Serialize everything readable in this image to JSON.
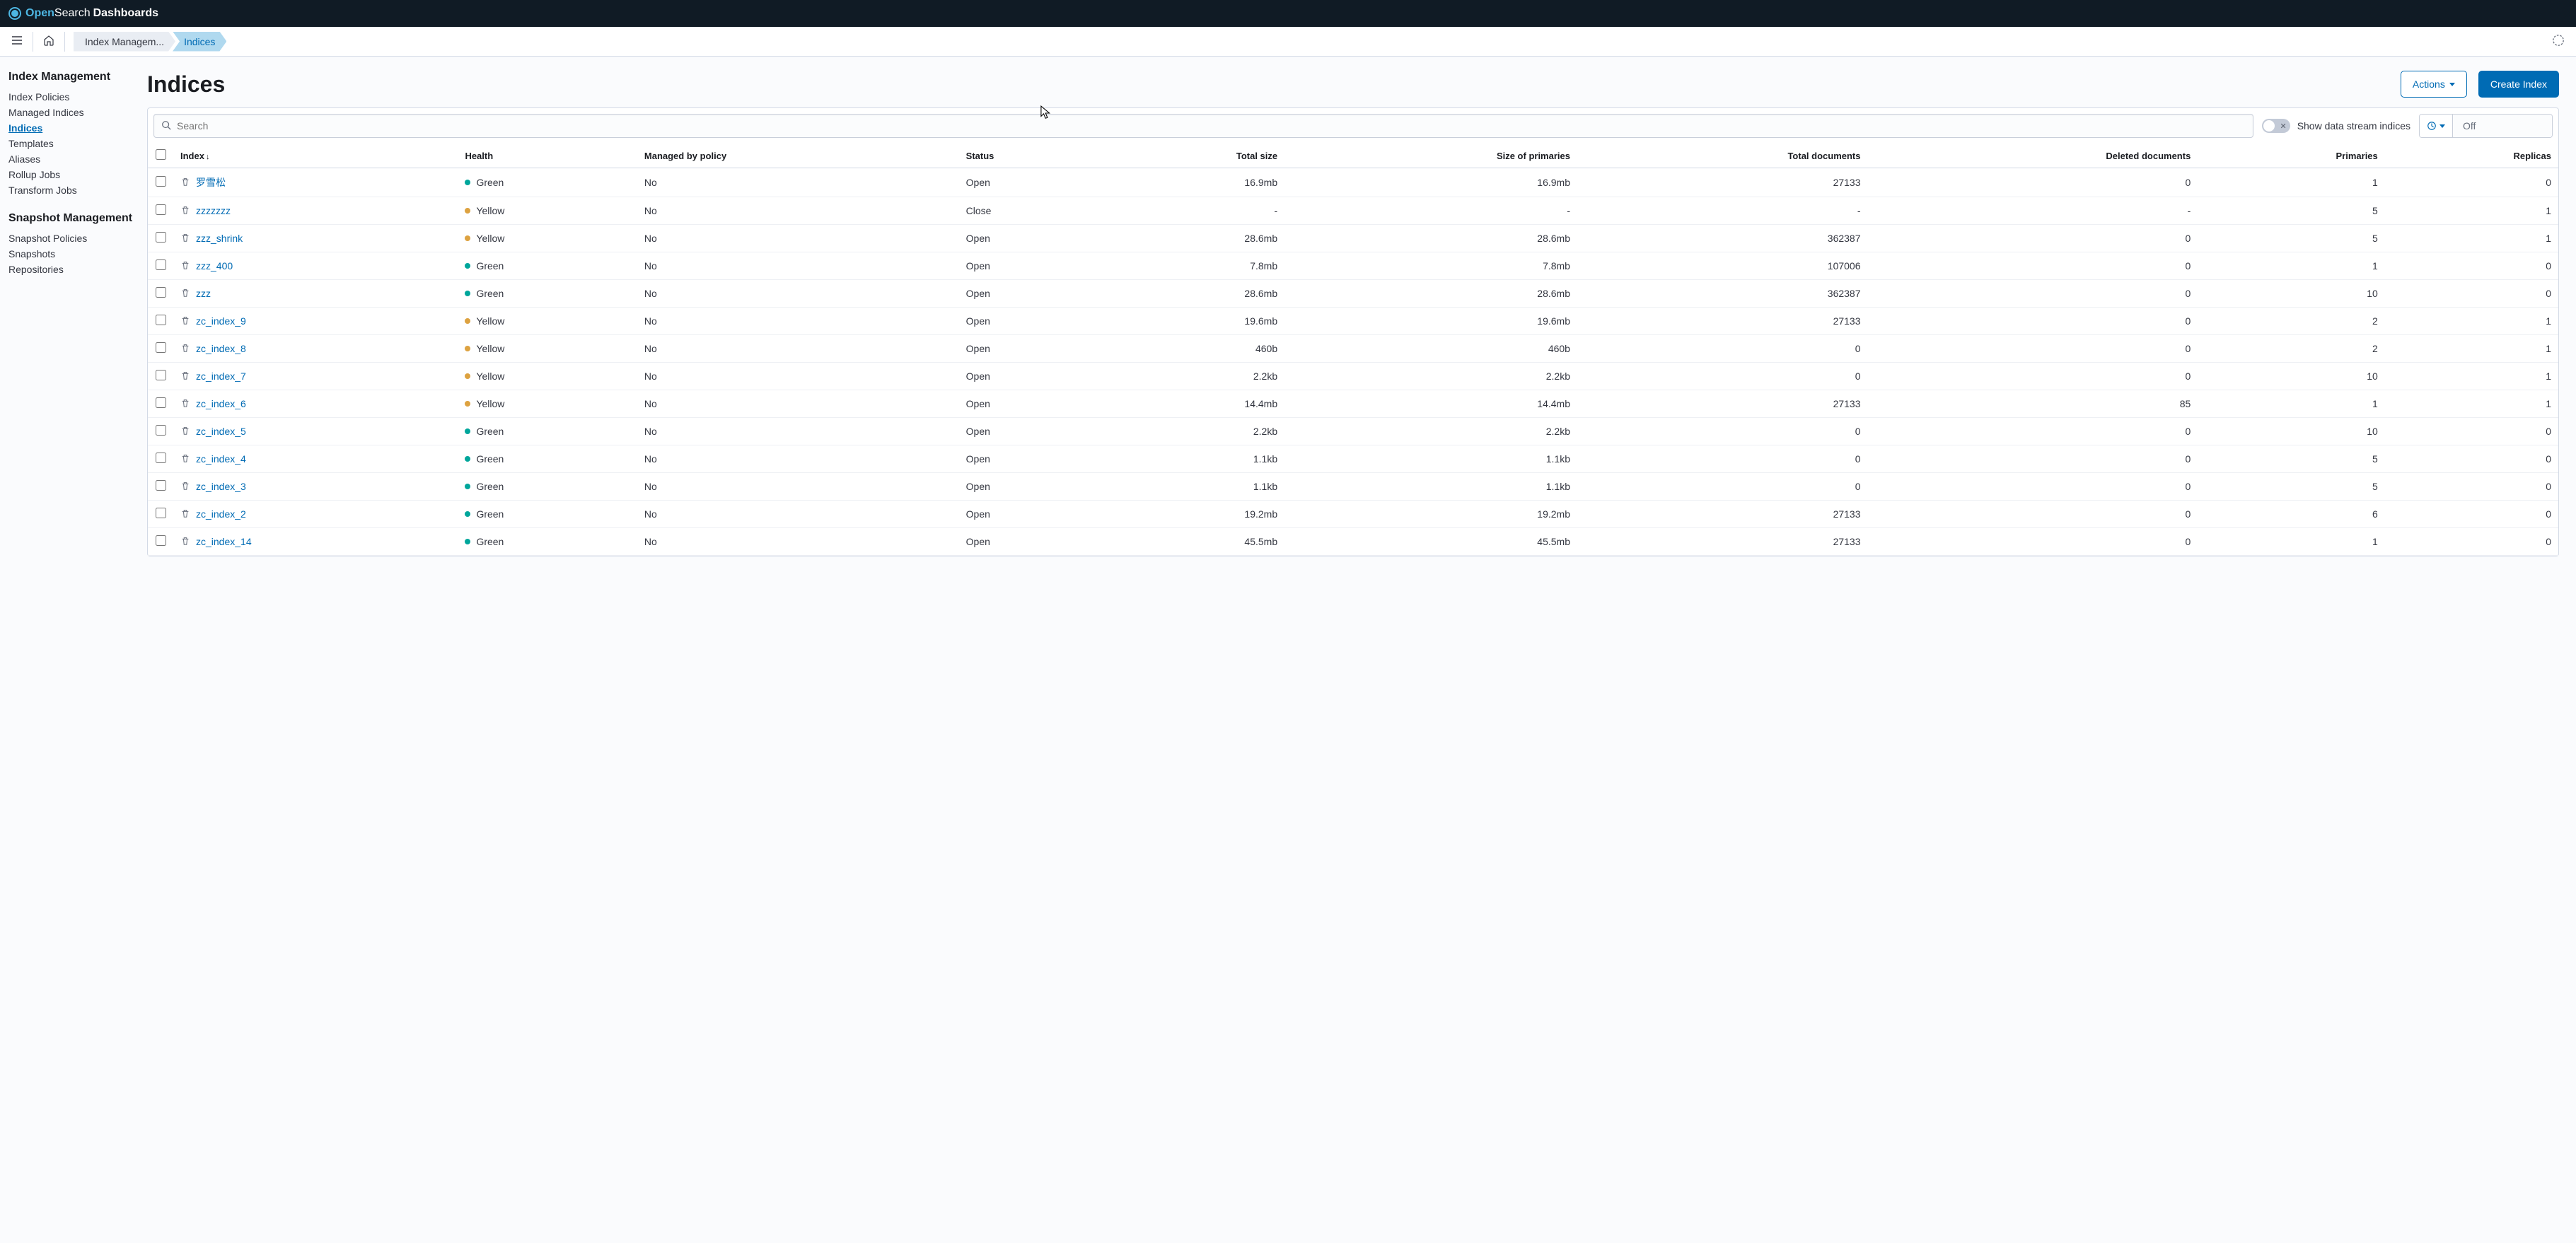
{
  "brand": {
    "open": "Open",
    "search": "Search",
    "dashboards": "Dashboards"
  },
  "breadcrumbs": [
    {
      "label": "Index Managem..."
    },
    {
      "label": "Indices"
    }
  ],
  "sidebar": {
    "group1": {
      "title": "Index Management",
      "items": [
        "Index Policies",
        "Managed Indices",
        "Indices",
        "Templates",
        "Aliases",
        "Rollup Jobs",
        "Transform Jobs"
      ]
    },
    "group2": {
      "title": "Snapshot Management",
      "items": [
        "Snapshot Policies",
        "Snapshots",
        "Repositories"
      ]
    }
  },
  "page": {
    "title": "Indices",
    "actions_label": "Actions",
    "create_label": "Create Index"
  },
  "toolbar": {
    "search_placeholder": "Search",
    "switch_label": "Show data stream indices",
    "refresh_state": "Off"
  },
  "columns": {
    "index": "Index",
    "health": "Health",
    "managed": "Managed by policy",
    "status": "Status",
    "total_size": "Total size",
    "size_primaries": "Size of primaries",
    "total_docs": "Total documents",
    "deleted_docs": "Deleted documents",
    "primaries": "Primaries",
    "replicas": "Replicas"
  },
  "rows": [
    {
      "index": "罗雪松",
      "health": "Green",
      "managed": "No",
      "status": "Open",
      "total_size": "16.9mb",
      "size_primaries": "16.9mb",
      "total_docs": "27133",
      "deleted_docs": "0",
      "primaries": "1",
      "replicas": "0"
    },
    {
      "index": "zzzzzzz",
      "health": "Yellow",
      "managed": "No",
      "status": "Close",
      "total_size": "-",
      "size_primaries": "-",
      "total_docs": "-",
      "deleted_docs": "-",
      "primaries": "5",
      "replicas": "1"
    },
    {
      "index": "zzz_shrink",
      "health": "Yellow",
      "managed": "No",
      "status": "Open",
      "total_size": "28.6mb",
      "size_primaries": "28.6mb",
      "total_docs": "362387",
      "deleted_docs": "0",
      "primaries": "5",
      "replicas": "1"
    },
    {
      "index": "zzz_400",
      "health": "Green",
      "managed": "No",
      "status": "Open",
      "total_size": "7.8mb",
      "size_primaries": "7.8mb",
      "total_docs": "107006",
      "deleted_docs": "0",
      "primaries": "1",
      "replicas": "0"
    },
    {
      "index": "zzz",
      "health": "Green",
      "managed": "No",
      "status": "Open",
      "total_size": "28.6mb",
      "size_primaries": "28.6mb",
      "total_docs": "362387",
      "deleted_docs": "0",
      "primaries": "10",
      "replicas": "0"
    },
    {
      "index": "zc_index_9",
      "health": "Yellow",
      "managed": "No",
      "status": "Open",
      "total_size": "19.6mb",
      "size_primaries": "19.6mb",
      "total_docs": "27133",
      "deleted_docs": "0",
      "primaries": "2",
      "replicas": "1"
    },
    {
      "index": "zc_index_8",
      "health": "Yellow",
      "managed": "No",
      "status": "Open",
      "total_size": "460b",
      "size_primaries": "460b",
      "total_docs": "0",
      "deleted_docs": "0",
      "primaries": "2",
      "replicas": "1"
    },
    {
      "index": "zc_index_7",
      "health": "Yellow",
      "managed": "No",
      "status": "Open",
      "total_size": "2.2kb",
      "size_primaries": "2.2kb",
      "total_docs": "0",
      "deleted_docs": "0",
      "primaries": "10",
      "replicas": "1"
    },
    {
      "index": "zc_index_6",
      "health": "Yellow",
      "managed": "No",
      "status": "Open",
      "total_size": "14.4mb",
      "size_primaries": "14.4mb",
      "total_docs": "27133",
      "deleted_docs": "85",
      "primaries": "1",
      "replicas": "1"
    },
    {
      "index": "zc_index_5",
      "health": "Green",
      "managed": "No",
      "status": "Open",
      "total_size": "2.2kb",
      "size_primaries": "2.2kb",
      "total_docs": "0",
      "deleted_docs": "0",
      "primaries": "10",
      "replicas": "0"
    },
    {
      "index": "zc_index_4",
      "health": "Green",
      "managed": "No",
      "status": "Open",
      "total_size": "1.1kb",
      "size_primaries": "1.1kb",
      "total_docs": "0",
      "deleted_docs": "0",
      "primaries": "5",
      "replicas": "0"
    },
    {
      "index": "zc_index_3",
      "health": "Green",
      "managed": "No",
      "status": "Open",
      "total_size": "1.1kb",
      "size_primaries": "1.1kb",
      "total_docs": "0",
      "deleted_docs": "0",
      "primaries": "5",
      "replicas": "0"
    },
    {
      "index": "zc_index_2",
      "health": "Green",
      "managed": "No",
      "status": "Open",
      "total_size": "19.2mb",
      "size_primaries": "19.2mb",
      "total_docs": "27133",
      "deleted_docs": "0",
      "primaries": "6",
      "replicas": "0"
    },
    {
      "index": "zc_index_14",
      "health": "Green",
      "managed": "No",
      "status": "Open",
      "total_size": "45.5mb",
      "size_primaries": "45.5mb",
      "total_docs": "27133",
      "deleted_docs": "0",
      "primaries": "1",
      "replicas": "0"
    }
  ]
}
